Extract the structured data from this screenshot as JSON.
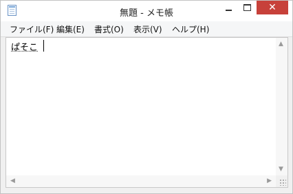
{
  "window": {
    "title": "無題 - メモ帳"
  },
  "menu": [
    {
      "label": "ファイル(F)"
    },
    {
      "label": "編集(E)"
    },
    {
      "label": "書式(O)"
    },
    {
      "label": "表示(V)"
    },
    {
      "label": "ヘルプ(H)"
    }
  ],
  "editor": {
    "text": "ぱそこ"
  },
  "icons": {
    "app": "notepad-icon",
    "minimize": "minimize-icon",
    "maximize": "maximize-icon",
    "close": "close-icon",
    "scroll_up": "arrow-up-icon",
    "scroll_down": "arrow-down-icon",
    "scroll_left": "arrow-left-icon",
    "scroll_right": "arrow-right-icon",
    "resize_grip": "resize-grip-icon"
  },
  "colors": {
    "close_button": "#c7413a",
    "window_border": "#c2c2c2"
  }
}
